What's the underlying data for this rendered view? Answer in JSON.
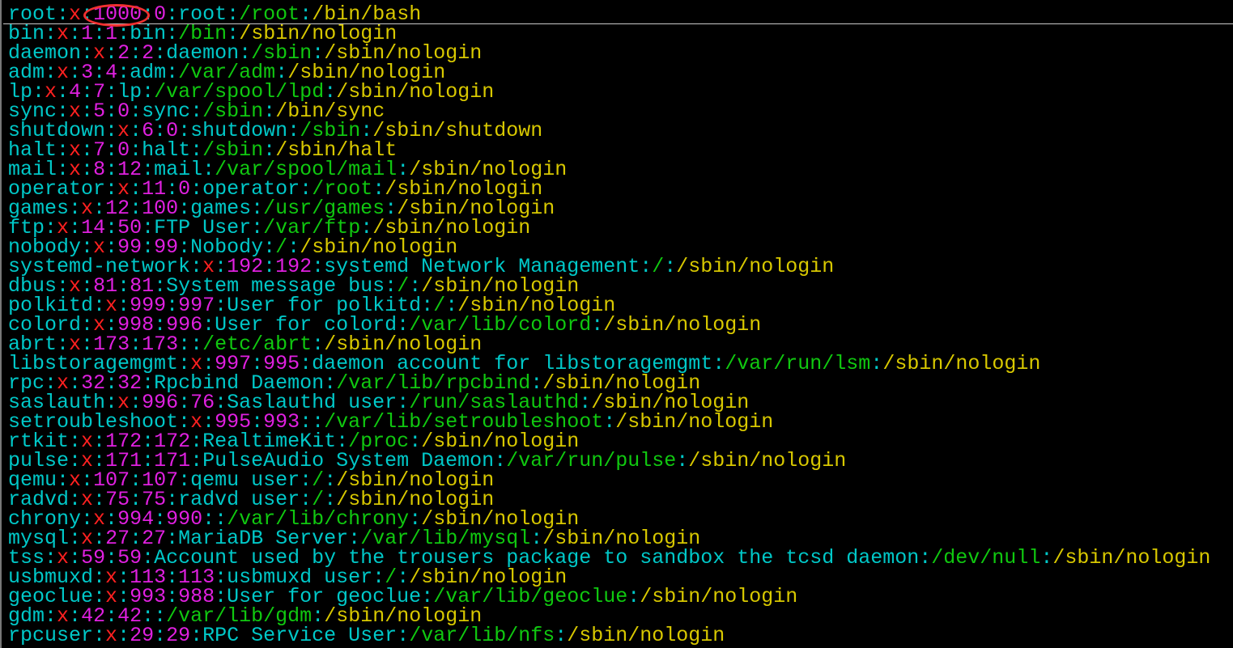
{
  "colors": {
    "username": "#00c8c8",
    "password": "#ff2020",
    "ids": "#e020e0",
    "gecos": "#00c8c8",
    "home": "#10c810",
    "shell": "#d8c800",
    "annotation": "#f03030"
  },
  "annotation": {
    "shape": "ellipse",
    "highlights": "1000"
  },
  "lines": [
    "root:x:1000:0:root:/root:/bin/bash",
    "bin:x:1:1:bin:/bin:/sbin/nologin",
    "daemon:x:2:2:daemon:/sbin:/sbin/nologin",
    "adm:x:3:4:adm:/var/adm:/sbin/nologin",
    "lp:x:4:7:lp:/var/spool/lpd:/sbin/nologin",
    "sync:x:5:0:sync:/sbin:/bin/sync",
    "shutdown:x:6:0:shutdown:/sbin:/sbin/shutdown",
    "halt:x:7:0:halt:/sbin:/sbin/halt",
    "mail:x:8:12:mail:/var/spool/mail:/sbin/nologin",
    "operator:x:11:0:operator:/root:/sbin/nologin",
    "games:x:12:100:games:/usr/games:/sbin/nologin",
    "ftp:x:14:50:FTP User:/var/ftp:/sbin/nologin",
    "nobody:x:99:99:Nobody:/:/sbin/nologin",
    "systemd-network:x:192:192:systemd Network Management:/:/sbin/nologin",
    "dbus:x:81:81:System message bus:/:/sbin/nologin",
    "polkitd:x:999:997:User for polkitd:/:/sbin/nologin",
    "colord:x:998:996:User for colord:/var/lib/colord:/sbin/nologin",
    "abrt:x:173:173::/etc/abrt:/sbin/nologin",
    "libstoragemgmt:x:997:995:daemon account for libstoragemgmt:/var/run/lsm:/sbin/nologin",
    "rpc:x:32:32:Rpcbind Daemon:/var/lib/rpcbind:/sbin/nologin",
    "saslauth:x:996:76:Saslauthd user:/run/saslauthd:/sbin/nologin",
    "setroubleshoot:x:995:993::/var/lib/setroubleshoot:/sbin/nologin",
    "rtkit:x:172:172:RealtimeKit:/proc:/sbin/nologin",
    "pulse:x:171:171:PulseAudio System Daemon:/var/run/pulse:/sbin/nologin",
    "qemu:x:107:107:qemu user:/:/sbin/nologin",
    "radvd:x:75:75:radvd user:/:/sbin/nologin",
    "chrony:x:994:990::/var/lib/chrony:/sbin/nologin",
    "mysql:x:27:27:MariaDB Server:/var/lib/mysql:/sbin/nologin",
    "tss:x:59:59:Account used by the trousers package to sandbox the tcsd daemon:/dev/null:/sbin/nologin",
    "usbmuxd:x:113:113:usbmuxd user:/:/sbin/nologin",
    "geoclue:x:993:988:User for geoclue:/var/lib/geoclue:/sbin/nologin",
    "gdm:x:42:42::/var/lib/gdm:/sbin/nologin",
    "rpcuser:x:29:29:RPC Service User:/var/lib/nfs:/sbin/nologin"
  ]
}
